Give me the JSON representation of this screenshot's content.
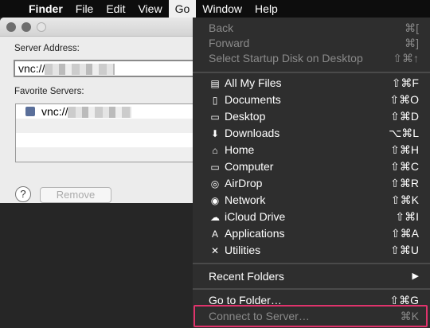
{
  "menubar": {
    "apple": "",
    "items": [
      "Finder",
      "File",
      "Edit",
      "View",
      "Go",
      "Window",
      "Help"
    ],
    "active": "Go"
  },
  "dialog": {
    "server_address_label": "Server Address:",
    "server_address_value": "vnc://",
    "favorites_label": "Favorite Servers:",
    "favorites": [
      "vnc://"
    ],
    "help": "?",
    "remove": "Remove"
  },
  "menu": {
    "nav": [
      {
        "label": "Back",
        "shortcut": "⌘[",
        "disabled": true
      },
      {
        "label": "Forward",
        "shortcut": "⌘]",
        "disabled": true
      },
      {
        "label": "Select Startup Disk on Desktop",
        "shortcut": "⇧⌘↑",
        "disabled": true
      }
    ],
    "places": [
      {
        "label": "All My Files",
        "shortcut": "⇧⌘F",
        "icon": "files-icon"
      },
      {
        "label": "Documents",
        "shortcut": "⇧⌘O",
        "icon": "documents-icon"
      },
      {
        "label": "Desktop",
        "shortcut": "⇧⌘D",
        "icon": "desktop-icon"
      },
      {
        "label": "Downloads",
        "shortcut": "⌥⌘L",
        "icon": "downloads-icon"
      },
      {
        "label": "Home",
        "shortcut": "⇧⌘H",
        "icon": "home-icon"
      },
      {
        "label": "Computer",
        "shortcut": "⇧⌘C",
        "icon": "computer-icon"
      },
      {
        "label": "AirDrop",
        "shortcut": "⇧⌘R",
        "icon": "airdrop-icon"
      },
      {
        "label": "Network",
        "shortcut": "⇧⌘K",
        "icon": "network-icon"
      },
      {
        "label": "iCloud Drive",
        "shortcut": "⇧⌘I",
        "icon": "cloud-icon"
      },
      {
        "label": "Applications",
        "shortcut": "⇧⌘A",
        "icon": "applications-icon"
      },
      {
        "label": "Utilities",
        "shortcut": "⇧⌘U",
        "icon": "utilities-icon"
      }
    ],
    "recent": {
      "label": "Recent Folders",
      "arrow": "▶"
    },
    "goto": {
      "label": "Go to Folder…",
      "shortcut": "⇧⌘G"
    },
    "connect": {
      "label": "Connect to Server…",
      "shortcut": "⌘K",
      "disabled": true
    }
  },
  "colors": {
    "highlight_box": "#e0336c"
  }
}
